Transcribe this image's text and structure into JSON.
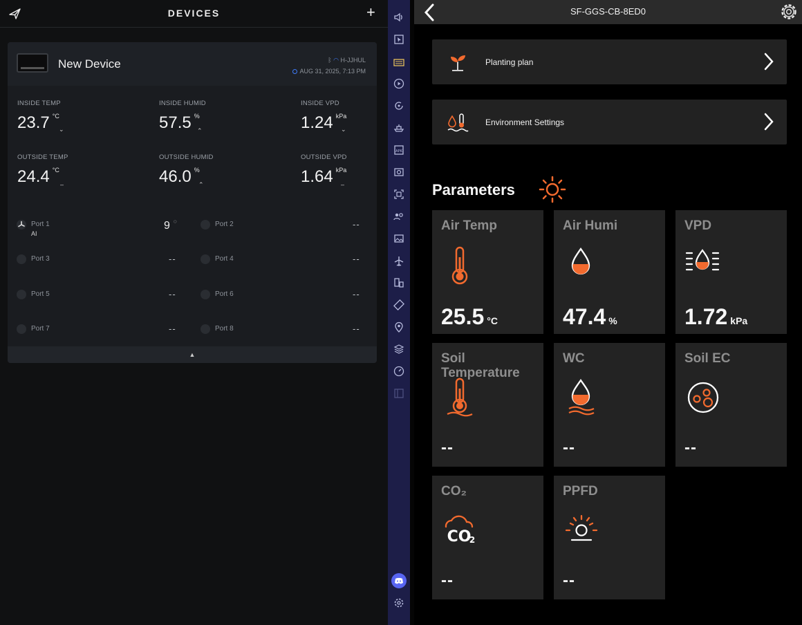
{
  "left": {
    "header_title": "DEVICES",
    "add_label": "+",
    "device": {
      "name": "New Device",
      "network": "H-JJHUL",
      "timestamp": "AUG 31, 2025, 7:13 PM"
    },
    "metrics": [
      {
        "label": "INSIDE TEMP",
        "value": "23.7",
        "unit": "°C",
        "trend": "⌄"
      },
      {
        "label": "INSIDE HUMID",
        "value": "57.5",
        "unit": "%",
        "trend": "⌃"
      },
      {
        "label": "INSIDE VPD",
        "value": "1.24",
        "unit": "kPa",
        "trend": "⌄"
      },
      {
        "label": "OUTSIDE TEMP",
        "value": "24.4",
        "unit": "°C",
        "trend": "–"
      },
      {
        "label": "OUTSIDE HUMID",
        "value": "46.0",
        "unit": "%",
        "trend": "⌃"
      },
      {
        "label": "OUTSIDE VPD",
        "value": "1.64",
        "unit": "kPa",
        "trend": "–"
      }
    ],
    "ports": [
      {
        "name": "Port 1",
        "sub": "AI",
        "value": "9"
      },
      {
        "name": "Port 2",
        "value": "--"
      },
      {
        "name": "Port 3",
        "value": "--"
      },
      {
        "name": "Port 4",
        "value": "--"
      },
      {
        "name": "Port 5",
        "value": "--"
      },
      {
        "name": "Port 6",
        "value": "--"
      },
      {
        "name": "Port 7",
        "value": "--"
      },
      {
        "name": "Port 8",
        "value": "--"
      }
    ],
    "collapse_glyph": "▲"
  },
  "sidebar": {
    "icons": [
      "volume-icon",
      "cursor-icon",
      "keyboard-icon",
      "play-icon",
      "rotate-icon",
      "ship-icon",
      "apk-icon",
      "screenshot-icon",
      "screen-record-icon",
      "people-icon",
      "image-icon",
      "airplane-icon",
      "devices-icon",
      "rotate-screen-icon",
      "location-icon",
      "layers-icon",
      "speed-icon",
      "panel-icon"
    ]
  },
  "right": {
    "header_title": "SF-GGS-CB-8ED0",
    "rows": [
      {
        "label": "Planting plan"
      },
      {
        "label": "Environment Settings"
      }
    ],
    "params_title": "Parameters",
    "tiles": [
      {
        "name": "Air Temp",
        "value": "25.5",
        "unit": "°C"
      },
      {
        "name": "Air Humi",
        "value": "47.4",
        "unit": "%"
      },
      {
        "name": "VPD",
        "value": "1.72",
        "unit": "kPa"
      },
      {
        "name": "Soil Temperature",
        "value": "--"
      },
      {
        "name": "WC",
        "value": "--"
      },
      {
        "name": "Soil EC",
        "value": "--"
      },
      {
        "name": "CO₂",
        "value": "--"
      },
      {
        "name": "PPFD",
        "value": "--"
      }
    ],
    "accent_color": "#f26a2e"
  }
}
